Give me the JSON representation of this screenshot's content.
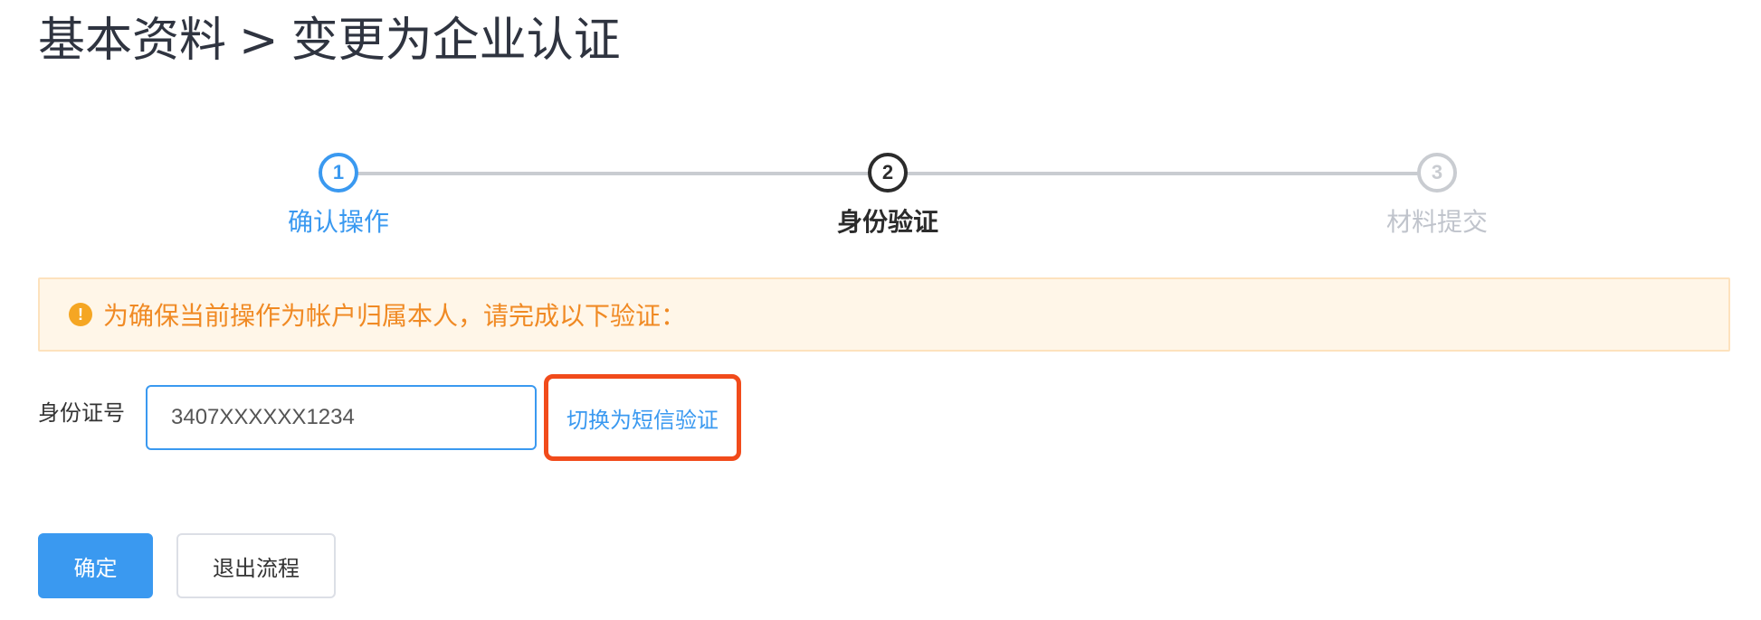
{
  "header": {
    "breadcrumb_parent": "基本资料",
    "separator": ">",
    "breadcrumb_current": "变更为企业认证"
  },
  "steps": [
    {
      "number": "1",
      "label": "确认操作",
      "status": "done"
    },
    {
      "number": "2",
      "label": "身份验证",
      "status": "active"
    },
    {
      "number": "3",
      "label": "材料提交",
      "status": "pending"
    }
  ],
  "alert": {
    "icon": "exclamation-circle-icon",
    "icon_glyph": "!",
    "text": "为确保当前操作为帐户归属本人，请完成以下验证："
  },
  "form": {
    "id_label": "身份证号",
    "id_value": "3407XXXXXX1234",
    "switch_link": "切换为短信验证"
  },
  "actions": {
    "confirm_label": "确定",
    "exit_label": "退出流程"
  },
  "colors": {
    "primary": "#3a99f0",
    "warning": "#f08a24",
    "highlight_border": "#f14b1b"
  }
}
